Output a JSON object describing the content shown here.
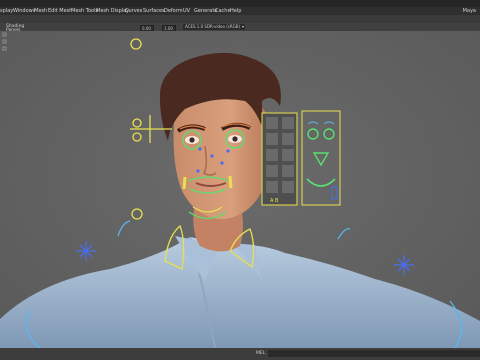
{
  "menubar": {
    "items": [
      "splay",
      "Windows",
      "Mesh",
      "Edit Mesh",
      "Mesh Tools",
      "Mesh Display",
      "Curves",
      "Surfaces",
      "Deform",
      "UV",
      "Generate",
      "Cache",
      "Help"
    ],
    "brand": "Maya"
  },
  "panel_menu": [
    "Shading",
    "Panels"
  ],
  "viewport_toolbar": {
    "near_value": "0.00",
    "far_value": "1.00",
    "color_space": "ACES 1.0 SDR-video (sRGB)"
  },
  "rig": {
    "tiles_label": "A B"
  },
  "statusbar": {
    "mel_label": "MEL"
  },
  "colors": {
    "rig_yellow": "#e8e050",
    "rig_green": "#59e070",
    "rig_blue": "#4a6cf0",
    "rig_cyan": "#58b8f0",
    "viewport_bg": "#636363"
  }
}
